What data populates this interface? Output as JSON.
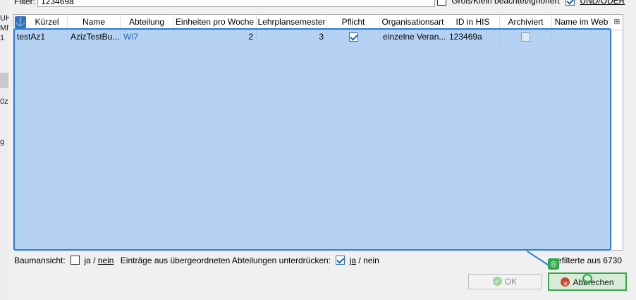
{
  "background": {
    "fragments": [
      "UK",
      "MN",
      "1",
      "0z",
      "g"
    ]
  },
  "filter": {
    "label": "Filter:",
    "value": "123469a",
    "case_label": "Groß/Klein beachtet/ignoriert",
    "case_checked": false,
    "andor_label": "UND/ODER",
    "andor_checked": true
  },
  "table": {
    "anchor_icon": "anchor-icon",
    "columns": [
      "Kürzel",
      "Name",
      "Abteilung",
      "Einheiten pro Woche",
      "Lehrplansemester",
      "Pflicht",
      "Organisationsart",
      "ID in HIS",
      "Archiviert",
      "Name im Web"
    ],
    "rows": [
      {
        "kuerzel": "testAz1",
        "name": "AzizTestBu...",
        "abteilung": "WI7",
        "einheiten": "2",
        "semester": "3",
        "pflicht": true,
        "organisationsart": "einzelne Veran...",
        "id_his": "123469a",
        "archiviert": false,
        "name_web": ""
      }
    ]
  },
  "bottom": {
    "baum_label": "Baumansicht:",
    "baum_ja": "ja",
    "baum_sep": "/",
    "baum_nein": "nein",
    "baum_checked": false,
    "unter_label": "Einträge aus übergeordneten Abteilungen unterdrücken:",
    "unter_ja": "ja",
    "unter_sep": "/",
    "unter_nein": "nein",
    "unter_checked": true,
    "count_text": "gefilterte aus 6730"
  },
  "buttons": {
    "ok_label": "OK",
    "cancel_label": "Abbrechen"
  },
  "colors": {
    "selection": "#b6d2f3",
    "selection_border": "#2c7bd6",
    "focus_green": "#2aa845",
    "link_blue": "#2a66c4"
  }
}
